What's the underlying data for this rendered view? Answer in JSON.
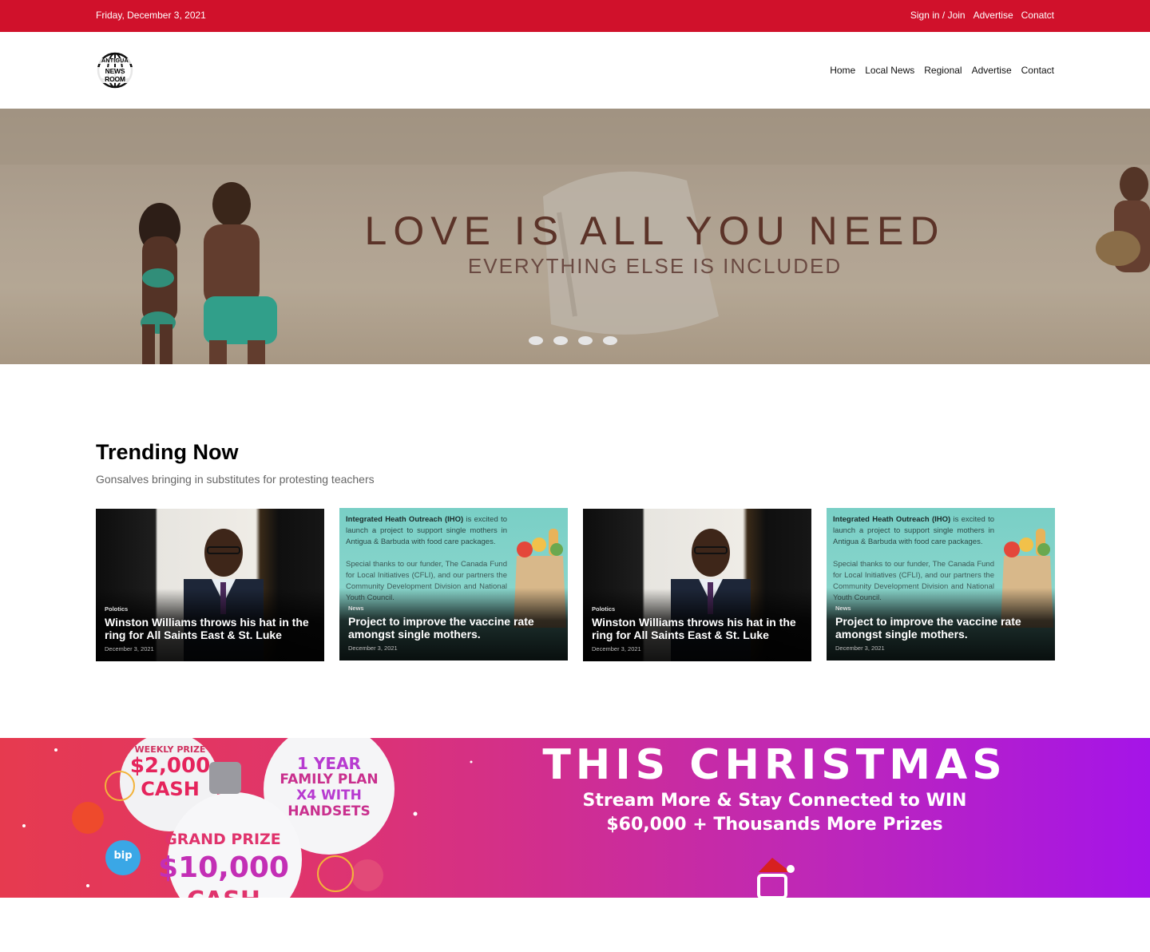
{
  "topbar": {
    "date": "Friday, December 3, 2021",
    "signin": "Sign in / Join",
    "advertise": "Advertise",
    "contact": "Conatct"
  },
  "logo": {
    "line1": "ANTIGUA",
    "line2": "NEWS ROOM"
  },
  "nav": {
    "home": "Home",
    "local": "Local News",
    "regional": "Regional",
    "advertise": "Advertise",
    "contact": "Contact"
  },
  "hero": {
    "title": "LOVE IS ALL YOU NEED",
    "subtitle": "EVERYTHING ELSE IS INCLUDED",
    "slide_count": 4
  },
  "trending": {
    "title": "Trending Now",
    "subtitle": "Gonsalves bringing in substitutes for protesting teachers",
    "cards": [
      {
        "category": "Polotics",
        "headline": "Winston Williams throws his hat in the ring for All Saints East & St. Luke",
        "date": "December 3, 2021"
      },
      {
        "category": "News",
        "headline": "Project to improve the vaccine rate amongst single mothers.",
        "date": "December 3, 2021",
        "flyer_bold": "Integrated Heath Outreach (IHO)",
        "flyer_p1": "is excited to launch a project to support single mothers in Antigua & Barbuda with food care packages.",
        "flyer_p2": "Special thanks to our funder, The Canada Fund for Local Initiatives (CFLI), and our partners the Community Development Division and National Youth Council."
      },
      {
        "category": "Polotics",
        "headline": "Winston Williams throws his hat in the ring for All Saints East & St. Luke",
        "date": "December 3, 2021"
      },
      {
        "category": "News",
        "headline": "Project to improve the vaccine rate amongst single mothers.",
        "date": "December 3, 2021",
        "flyer_bold": "Integrated Heath Outreach (IHO)",
        "flyer_p1": "is excited to launch a project to support single mothers in Antigua & Barbuda with food care packages.",
        "flyer_p2": "Special thanks to our funder, The Canada Fund for Local Initiatives (CFLI), and our partners the Community Development Division and National Youth Council."
      }
    ]
  },
  "promo": {
    "title": "THIS CHRISTMAS",
    "line1": "Stream More & Stay Connected to WIN",
    "line2": "$60,000 + Thousands More Prizes",
    "weekly_label": "WEEKLY PRIZE",
    "weekly_amount": "$2,000",
    "weekly_unit": "CASH",
    "family_1": "1 YEAR",
    "family_2": "FAMILY PLAN",
    "family_3": "X4 WITH",
    "family_4": "HANDSETS",
    "grand_label": "GRAND PRIZE",
    "grand_amount": "$10,000",
    "grand_unit": "CASH",
    "badge_bip": "bip"
  },
  "colors": {
    "brand_red": "#d0112b",
    "promo_purple": "#a514e8"
  }
}
